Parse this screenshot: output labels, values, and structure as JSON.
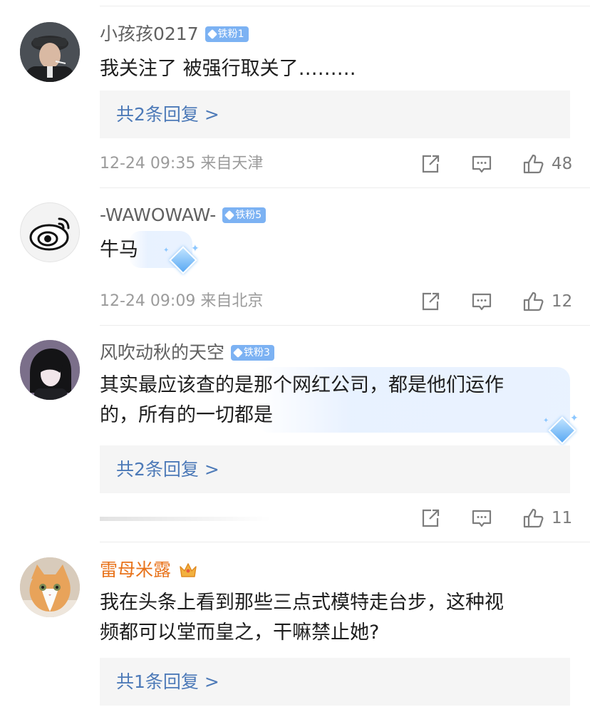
{
  "comments": [
    {
      "username": "小孩孩0217",
      "badge": "铁粉1",
      "text": "我关注了 被强行取关了………",
      "replies": "共2条回复 >",
      "time": "12-24 09:35 来自天津",
      "likes": "48"
    },
    {
      "username": "-WAWOWAW-",
      "badge": "铁粉5",
      "text": "牛马",
      "time": "12-24 09:09 来自北京",
      "likes": "12"
    },
    {
      "username": "风吹动秋的天空",
      "badge": "铁粉3",
      "text_line1": "其实最应该查的是那个网红公司，都是他们运作",
      "text_line2": "的，所有的一切都是",
      "replies": "共2条回复 >",
      "likes": "11"
    },
    {
      "username": "雷母米露",
      "text_line1": "我在头条上看到那些三点式模特走台步，这种视",
      "text_line2": "频都可以堂而皇之，干嘛禁止她?",
      "replies": "共1条回复 >"
    }
  ],
  "colors": {
    "username": "#606060",
    "username_vip": "#e8731b",
    "badge": "#7cb2f3",
    "link": "#4d7ab8",
    "meta": "#9b9b9b"
  },
  "icons": [
    "share-icon",
    "comment-icon",
    "like-icon",
    "weibo-logo-icon",
    "crown-icon",
    "diamond-icon"
  ]
}
